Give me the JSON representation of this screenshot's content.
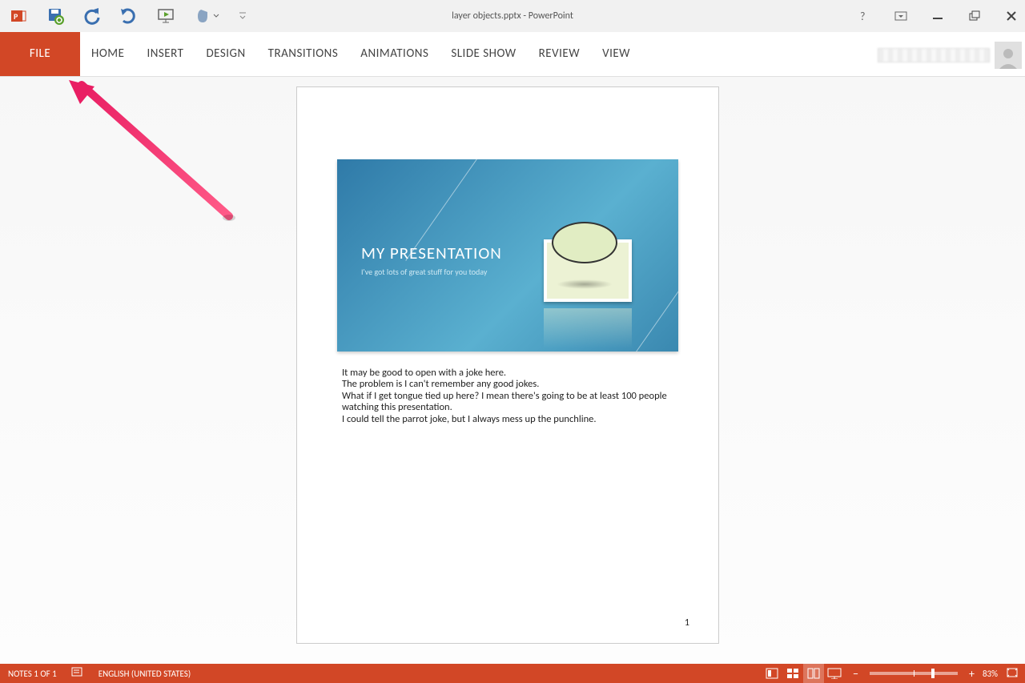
{
  "title": "layer objects.pptx - PowerPoint",
  "tabs": [
    "FILE",
    "HOME",
    "INSERT",
    "DESIGN",
    "TRANSITIONS",
    "ANIMATIONS",
    "SLIDE SHOW",
    "REVIEW",
    "VIEW"
  ],
  "active_tab_index": 0,
  "slide": {
    "title": "MY PRESENTATION",
    "subtitle": "I've got lots of great stuff for you today"
  },
  "notes": [
    "It may be good to open with a joke here.",
    "The problem is I can't remember any good jokes.",
    "What if I get tongue tied up here? I mean there's going to be at least 100 people watching this presentation.",
    "I could tell the parrot joke, but I always mess up the punchline."
  ],
  "page_number": "1",
  "status": {
    "notes": "NOTES 1 OF 1",
    "language": "ENGLISH (UNITED STATES)",
    "zoom": "83%"
  }
}
